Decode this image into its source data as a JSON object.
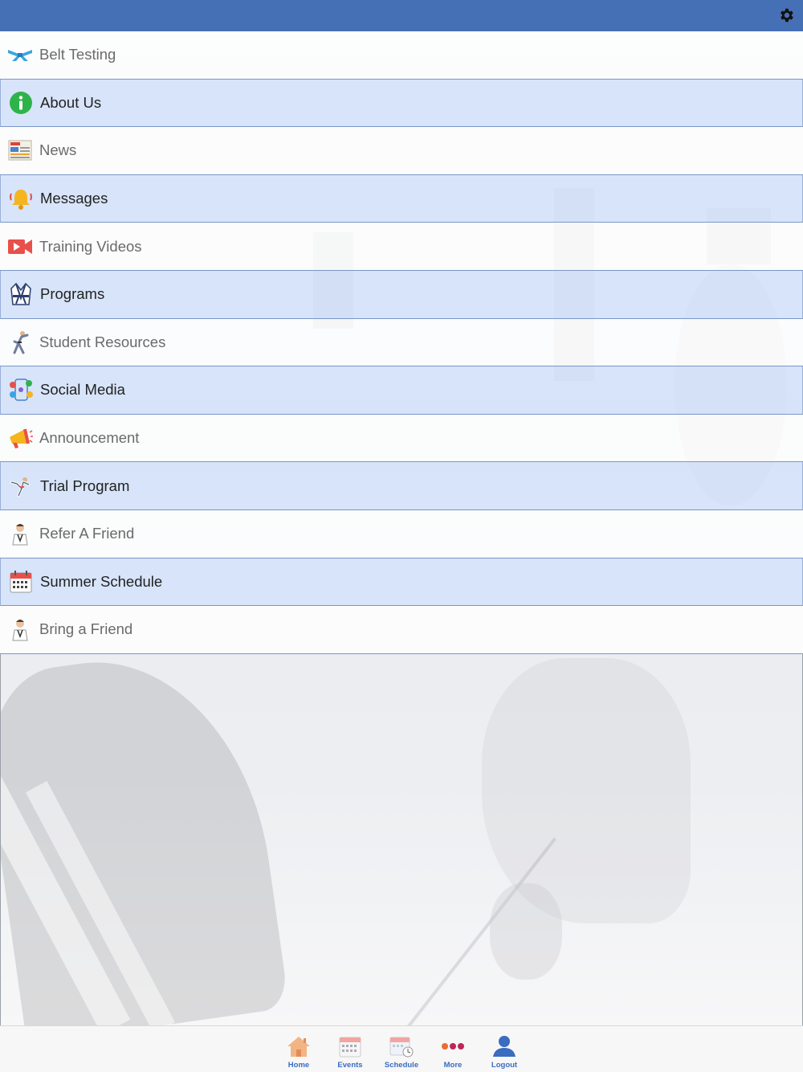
{
  "menu": {
    "items": [
      {
        "label": "Belt Testing",
        "icon": "belt-icon"
      },
      {
        "label": "About Us",
        "icon": "info-icon"
      },
      {
        "label": "News",
        "icon": "newspaper-icon"
      },
      {
        "label": "Messages",
        "icon": "bell-icon"
      },
      {
        "label": "Training Videos",
        "icon": "video-icon"
      },
      {
        "label": "Programs",
        "icon": "uniform-icon"
      },
      {
        "label": "Student Resources",
        "icon": "karate-figure-icon"
      },
      {
        "label": "Social Media",
        "icon": "social-media-icon"
      },
      {
        "label": "Announcement",
        "icon": "megaphone-icon"
      },
      {
        "label": "Trial Program",
        "icon": "kick-figure-icon"
      },
      {
        "label": "Refer A Friend",
        "icon": "person-icon"
      },
      {
        "label": "Summer Schedule",
        "icon": "calendar-icon"
      },
      {
        "label": "Bring a Friend",
        "icon": "person-icon"
      }
    ]
  },
  "tabbar": {
    "tabs": [
      {
        "label": "Home",
        "icon": "home-icon"
      },
      {
        "label": "Events",
        "icon": "events-calendar-icon"
      },
      {
        "label": "Schedule",
        "icon": "schedule-icon"
      },
      {
        "label": "More",
        "icon": "more-dots-icon"
      },
      {
        "label": "Logout",
        "icon": "user-icon"
      }
    ]
  },
  "colors": {
    "header": "#4670b5",
    "row_blue": "#d4e2fa",
    "tab_label": "#3a6cc0"
  }
}
